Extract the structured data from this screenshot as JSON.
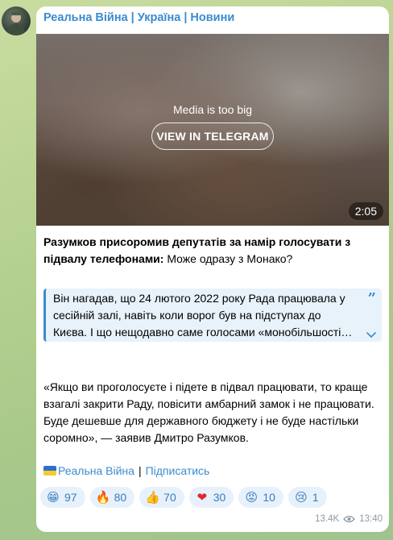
{
  "channel": {
    "title": "Реальна Війна | Україна | Новини"
  },
  "media": {
    "notice": "Media is too big",
    "button_label": "VIEW IN TELEGRAM",
    "duration": "2:05"
  },
  "post": {
    "headline_bold": "Разумков присоромив депутатів за намір голосувати з підвалу телефонами:",
    "headline_rest": " Може одразу з Монако?",
    "quote_line1": "Він нагадав, що 24 лютого 2022 року Рада працювала у сесійній залі, навіть коли ворог був на підступах до",
    "quote_line3": "Києва. І що нещодавно саме голосами «монобільшості»…",
    "paragraph": "«Якщо ви проголосуєте і підете в підвал працювати, то краще взагалі закрити Раду, повісити амбарний замок і не працювати. Буде дешевше для державного бюджету і не буде настільки соромно», — заявив Дмитро Разумков."
  },
  "footer_links": {
    "channel_link": "Реальна Війна",
    "separator": "|",
    "subscribe_link": "Підписатись"
  },
  "reactions": [
    {
      "emoji": "😁",
      "icon": "grin-emoji",
      "count": "97"
    },
    {
      "emoji": "🔥",
      "icon": "fire-emoji",
      "count": "80"
    },
    {
      "emoji": "👍",
      "icon": "thumbs-up-emoji",
      "count": "70"
    },
    {
      "emoji": "❤",
      "icon": "heart-emoji",
      "count": "30"
    },
    {
      "emoji": "😡",
      "icon": "angry-emoji",
      "count": "10"
    },
    {
      "emoji": "😢",
      "icon": "cry-emoji",
      "count": "1"
    }
  ],
  "meta": {
    "views": "13.4K",
    "time": "13:40"
  },
  "colors": {
    "accent": "#3a8ccf",
    "bubble": "#ffffff",
    "reaction_bg": "#e7f1fb"
  }
}
